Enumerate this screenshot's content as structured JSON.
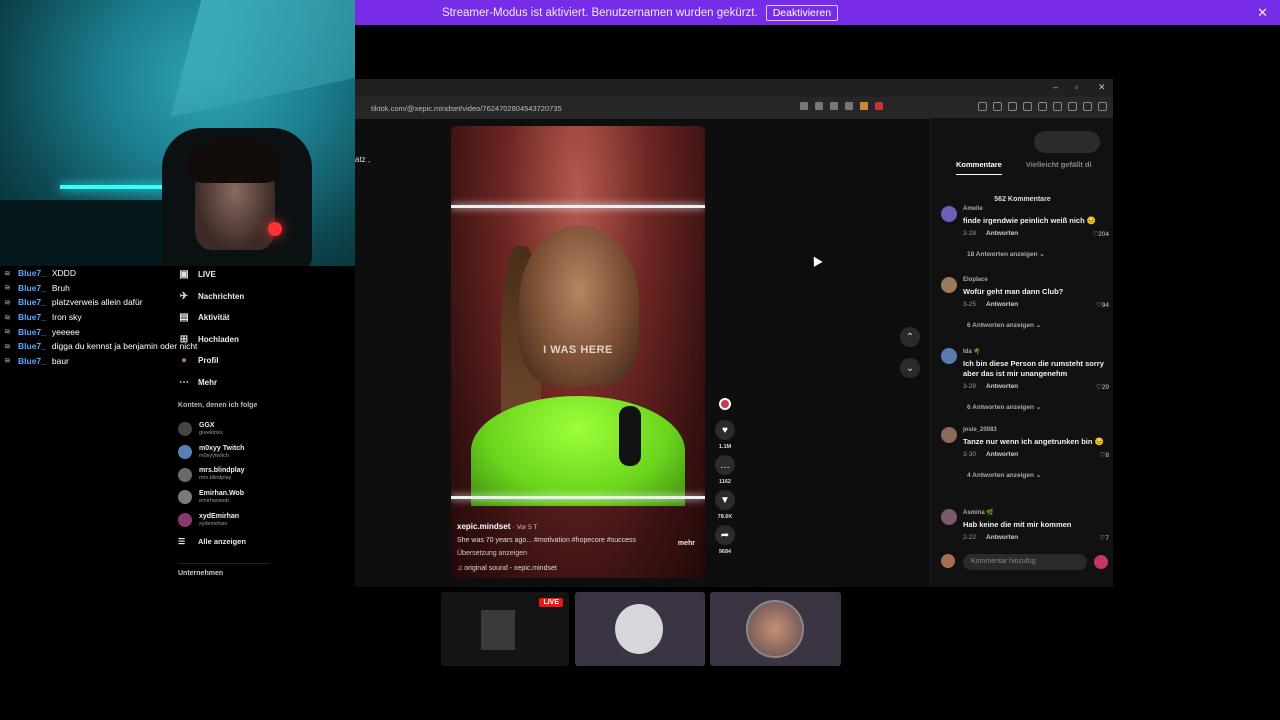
{
  "banner": {
    "text": "Streamer-Modus ist aktiviert. Benutzernamen wurden gekürzt.",
    "button": "Deaktivieren",
    "close": "✕"
  },
  "chat": [
    {
      "user": "Blue7_",
      "msg": "XDDD"
    },
    {
      "user": "Blue7_",
      "msg": "Bruh"
    },
    {
      "user": "Blue7_",
      "msg": "platzverweis allein dafür"
    },
    {
      "user": "Blue7_",
      "msg": "Iron sky"
    },
    {
      "user": "Blue7_",
      "msg": "yeeeee"
    },
    {
      "user": "Blue7_",
      "msg": "digga du kennst ja benjamin oder nicht"
    },
    {
      "user": "Blue7_",
      "msg": "baur"
    }
  ],
  "chat_fragment": "atz ,",
  "browser": {
    "url": "tiktok.com/@xepic.mindset/video/7624702804543720735"
  },
  "sidebar": {
    "nav": [
      {
        "icon": "▣",
        "label": "LIVE"
      },
      {
        "icon": "✈",
        "label": "Nachrichten"
      },
      {
        "icon": "▤",
        "label": "Aktivität"
      },
      {
        "icon": "⊞",
        "label": "Hochladen"
      },
      {
        "icon": "●",
        "label": "Profil"
      },
      {
        "icon": "⋯",
        "label": "Mehr"
      }
    ],
    "following_title": "Konten, denen ich folge",
    "following": [
      {
        "name": "GGX",
        "handle": "greektokx",
        "color": "#444"
      },
      {
        "name": "m0xyy Twitch",
        "handle": "m0xyytwitch",
        "color": "#5a7fb0"
      },
      {
        "name": "mrs.blindplay",
        "handle": "mrs.blindplay",
        "color": "#6a6a6a"
      },
      {
        "name": "Emirhan.Wob",
        "handle": "emirhanwob",
        "color": "#7a7a7a"
      },
      {
        "name": "xydEmirhan",
        "handle": "xydemirhan",
        "color": "#8a3a6a"
      }
    ],
    "show_all": "Alle anzeigen",
    "company": "Unternehmen"
  },
  "video": {
    "overlay_text": "I WAS HERE",
    "creator": "xepic.mindset",
    "time": "· Vor 5 T",
    "description": "She was 70 years ago... #motivation #hopecore #success",
    "more": "mehr",
    "translation": "Übersetzung anzeigen",
    "sound": "original sound - xepic.mindset"
  },
  "actions": [
    {
      "icon": "♥",
      "count": "1.1M"
    },
    {
      "icon": "…",
      "count": "1162"
    },
    {
      "icon": "▼",
      "count": "78.6K"
    },
    {
      "icon": "➦",
      "count": "9684"
    }
  ],
  "comments": {
    "tab_active": "Kommentare",
    "tab_inactive": "Vielleicht gefällt di",
    "count": "562 Kommentare",
    "items": [
      {
        "user": "Amelie",
        "text": "finde irgendwie peinlich weiß nich 😣",
        "date": "3-28",
        "reply": "Antworten",
        "likes": "♡204",
        "more": "18 Antworten anzeigen ⌄",
        "color": "#6b5fb8"
      },
      {
        "user": "Eloplace",
        "text": "Wofür geht man dann Club?",
        "date": "3-25",
        "reply": "Antworten",
        "likes": "♡94",
        "more": "6 Antworten anzeigen ⌄",
        "color": "#9a7a5a"
      },
      {
        "user": "Ida 🌴",
        "text": "Ich bin diese Person die rumsteht sorry aber das ist mir unangenehm",
        "date": "3-28",
        "reply": "Antworten",
        "likes": "♡29",
        "more": "6 Antworten anzeigen ⌄",
        "color": "#5a7ab0"
      },
      {
        "user": "josie_20083",
        "text": "Tanze nur wenn ich angetrunken bin 😣",
        "date": "3-30",
        "reply": "Antworten",
        "likes": "♡8",
        "more": "4 Antworten anzeigen ⌄",
        "color": "#8a6a5a"
      },
      {
        "user": "Asmina 🌿",
        "text": "Hab keine die mit mir kommen",
        "date": "2-22",
        "reply": "Antworten",
        "likes": "♡7",
        "more": "",
        "color": "#7a5a6a"
      }
    ],
    "input_placeholder": "Kommentar hinzufüg"
  },
  "thumbnails": [
    {
      "live": "LIVE"
    }
  ],
  "colors": {
    "banner": "#772ce8",
    "chat_user": "#5aa9ff",
    "live_red": "#e91916",
    "dress_green": "#7de22a"
  }
}
